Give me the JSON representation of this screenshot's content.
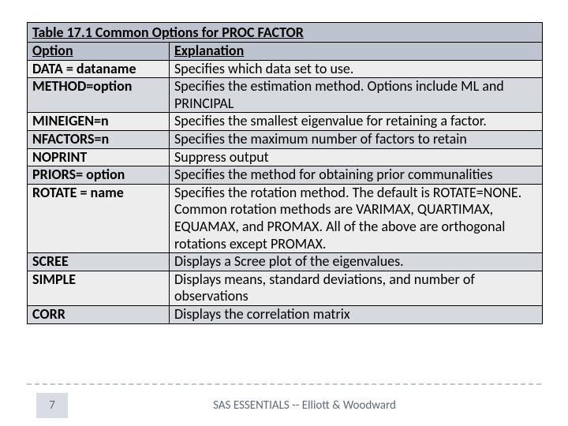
{
  "table": {
    "title": "Table 17.1 Common Options for PROC FACTOR",
    "header": {
      "option": "Option",
      "explanation": "Explanation"
    },
    "rows": [
      {
        "option": "DATA = dataname",
        "explanation": "Specifies which data set to use."
      },
      {
        "option": "METHOD=option",
        "explanation": "Specifies the estimation method. Options include ML and PRINCIPAL"
      },
      {
        "option": "MINEIGEN=n",
        "explanation": "Specifies the smallest eigenvalue for retaining a factor."
      },
      {
        "option": "NFACTORS=n",
        "explanation": "Specifies the maximum number of factors to retain"
      },
      {
        "option": "NOPRINT",
        "explanation": "Suppress output"
      },
      {
        "option": "PRIORS= option",
        "explanation": "Specifies the method for obtaining prior communalities"
      },
      {
        "option": "ROTATE = name",
        "explanation": "Specifies the rotation method. The default is ROTATE=NONE. Common rotation methods are VARIMAX, QUARTIMAX, EQUAMAX, and PROMAX.  All of the above are orthogonal rotations except PROMAX."
      },
      {
        "option": "SCREE",
        "explanation": "Displays a Scree plot of the eigenvalues."
      },
      {
        "option": "SIMPLE",
        "explanation": "Displays means, standard deviations, and number of observations"
      },
      {
        "option": "CORR",
        "explanation": "Displays the correlation matrix"
      }
    ]
  },
  "footer": {
    "page_number": "7",
    "source": "SAS ESSENTIALS -- Elliott & Woodward"
  }
}
